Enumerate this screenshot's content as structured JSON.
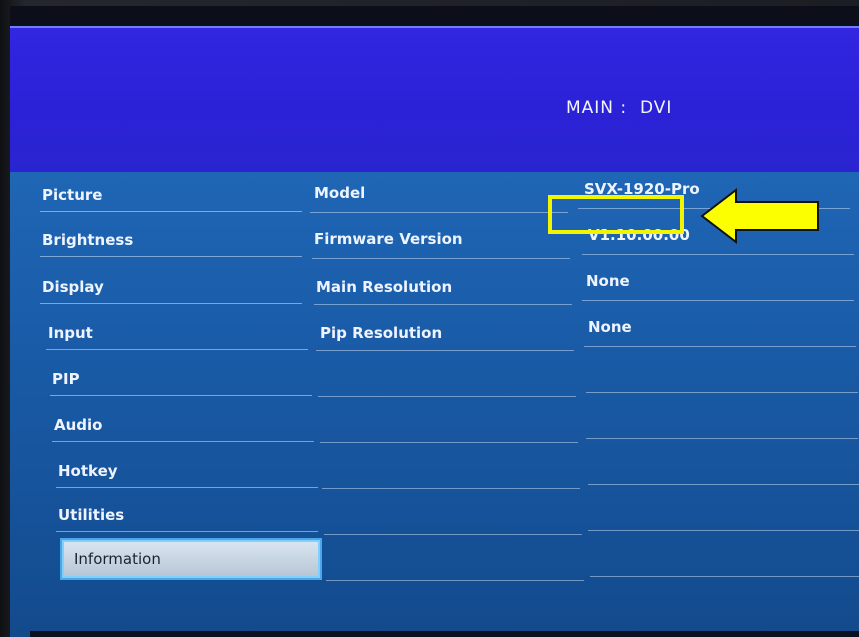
{
  "header": {
    "title": "MAIN :  DVI"
  },
  "menu": {
    "items": [
      {
        "label": "Picture"
      },
      {
        "label": "Brightness"
      },
      {
        "label": "Display"
      },
      {
        "label": "Input"
      },
      {
        "label": "PIP"
      },
      {
        "label": "Audio"
      },
      {
        "label": "Hotkey"
      },
      {
        "label": "Utilities"
      },
      {
        "label": "Information"
      }
    ],
    "selected": "Information"
  },
  "info": {
    "rows": [
      {
        "label": "Model",
        "value": "SVX-1920-Pro"
      },
      {
        "label": "Firmware Version",
        "value": "V1.10.00.00"
      },
      {
        "label": "Main Resolution",
        "value": "None"
      },
      {
        "label": "Pip Resolution",
        "value": "None"
      }
    ]
  },
  "colors": {
    "header_blue": "#2b22d8",
    "panel_blue": "#1a5ca8",
    "highlight_yellow": "#f3f400"
  },
  "annotation": {
    "icon": "arrow-left-icon",
    "target": "Firmware Version value"
  }
}
